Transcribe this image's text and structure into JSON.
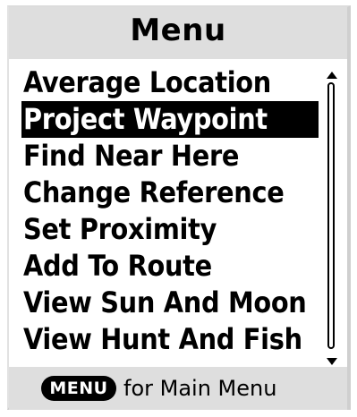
{
  "header": {
    "title": "Menu"
  },
  "menu": {
    "items": [
      {
        "label": "Average Location",
        "selected": false
      },
      {
        "label": "Project Waypoint",
        "selected": true
      },
      {
        "label": "Find Near Here",
        "selected": false
      },
      {
        "label": "Change Reference",
        "selected": false
      },
      {
        "label": "Set Proximity",
        "selected": false
      },
      {
        "label": "Add To Route",
        "selected": false
      },
      {
        "label": "View Sun And Moon",
        "selected": false
      },
      {
        "label": "View Hunt And Fish",
        "selected": false
      }
    ]
  },
  "footer": {
    "key_label": "MENU",
    "hint": "for Main Menu"
  },
  "colors": {
    "selection_background": "#000000",
    "selection_text": "#ffffff",
    "bar_background": "#dedede"
  },
  "icons": {
    "scroll_up": "up-arrow-icon",
    "scroll_down": "down-arrow-icon"
  }
}
